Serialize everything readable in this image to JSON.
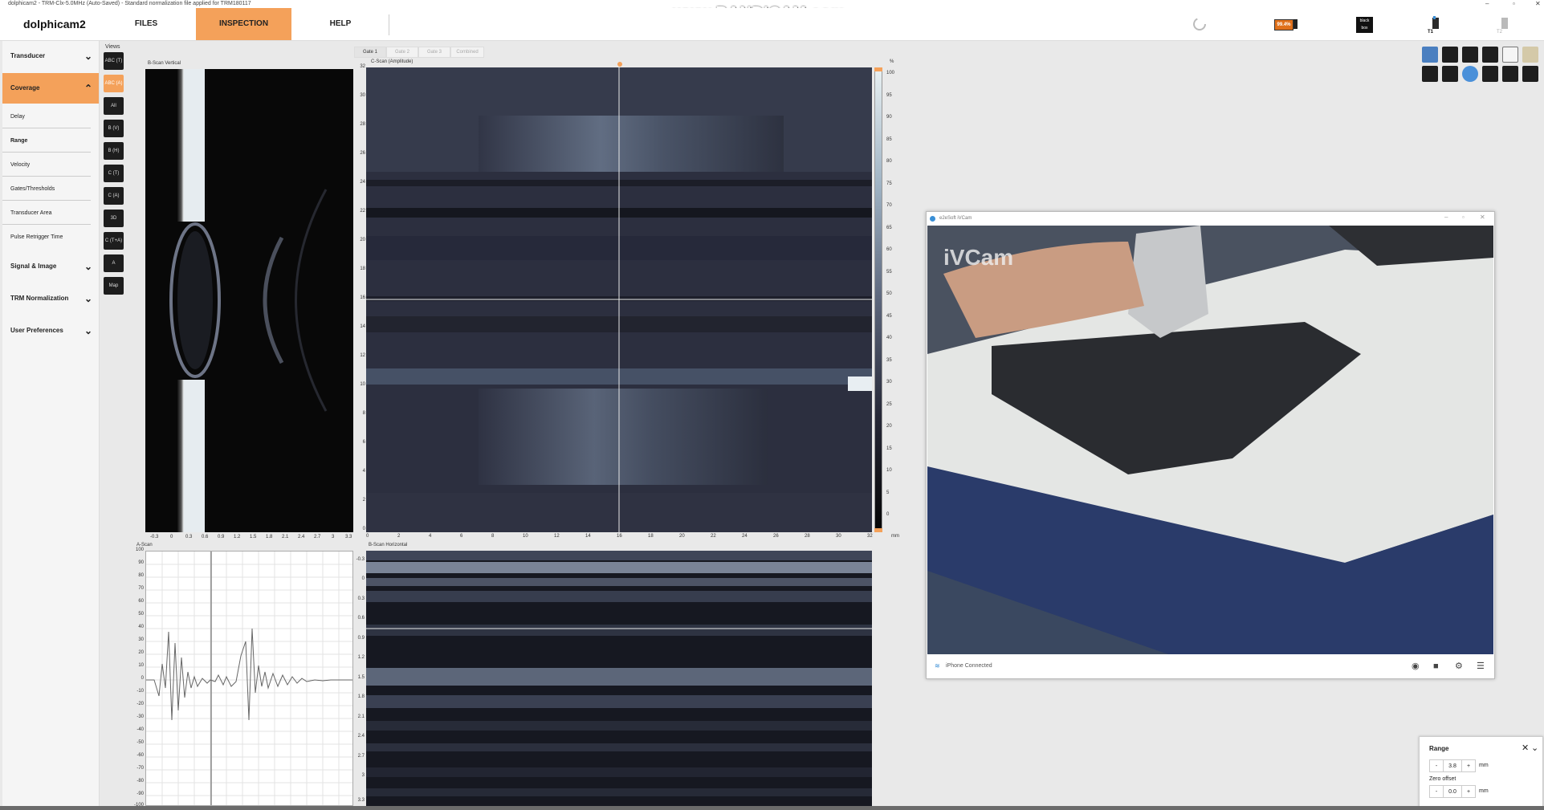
{
  "window": {
    "title": "dolphicam2 - TRM-Clx-5.0MHz (Auto-Saved) - Standard normalization file applied for TRM180117",
    "watermark": "www.BANDICAM.com"
  },
  "header": {
    "logo": "dolphicam2",
    "tabs": [
      {
        "label": "FILES"
      },
      {
        "label": "INSPECTION"
      },
      {
        "label": "HELP"
      }
    ],
    "battery_label": "99.4%",
    "blackbox_label": "black box",
    "t1_label": "T1",
    "t2_label": "T2"
  },
  "sidebar": {
    "sections": [
      {
        "label": "Transducer"
      },
      {
        "label": "Coverage"
      },
      {
        "label": "Signal & Image"
      },
      {
        "label": "TRM Normalization"
      },
      {
        "label": "User Preferences"
      }
    ],
    "coverage_items": [
      {
        "label": "Delay"
      },
      {
        "label": "Range"
      },
      {
        "label": "Velocity"
      },
      {
        "label": "Gates/Thresholds"
      },
      {
        "label": "Transducer Area"
      },
      {
        "label": "Pulse Retrigger Time"
      }
    ]
  },
  "views": {
    "label": "Views",
    "buttons": [
      {
        "label": "ABC (T)"
      },
      {
        "label": "ABC (A)"
      },
      {
        "label": "All"
      },
      {
        "label": "B (V)"
      },
      {
        "label": "B (H)"
      },
      {
        "label": "C (T)"
      },
      {
        "label": "C (A)"
      },
      {
        "label": "3D"
      },
      {
        "label": "C (T+A)"
      },
      {
        "label": "A"
      },
      {
        "label": "Map"
      }
    ]
  },
  "gates": {
    "tabs": [
      {
        "label": "Gate 1"
      },
      {
        "label": "Gate 2"
      },
      {
        "label": "Gate 3"
      },
      {
        "label": "Combined"
      }
    ]
  },
  "panels": {
    "bscan_vertical": {
      "title": "B-Scan Vertical",
      "x_ticks": [
        "-0.3",
        "0",
        "0.3",
        "0.6",
        "0.9",
        "1.2",
        "1.5",
        "1.8",
        "2.1",
        "2.4",
        "2.7",
        "3",
        "3.3"
      ]
    },
    "cscan": {
      "title": "C-Scan (Amplitude)",
      "y_ticks": [
        "32",
        "30",
        "28",
        "26",
        "24",
        "22",
        "20",
        "18",
        "16",
        "14",
        "12",
        "10",
        "8",
        "6",
        "4",
        "2",
        "0"
      ],
      "x_ticks": [
        "0",
        "2",
        "4",
        "6",
        "8",
        "10",
        "12",
        "14",
        "16",
        "18",
        "20",
        "22",
        "24",
        "26",
        "28",
        "30",
        "32"
      ],
      "x_unit": "mm",
      "colorbar_unit": "%",
      "colorbar_ticks": [
        "100",
        "95",
        "90",
        "85",
        "80",
        "75",
        "70",
        "65",
        "60",
        "55",
        "50",
        "45",
        "40",
        "35",
        "30",
        "25",
        "20",
        "15",
        "10",
        "5",
        "0"
      ]
    },
    "ascan": {
      "title": "A-Scan",
      "y_ticks": [
        "100",
        "90",
        "80",
        "70",
        "60",
        "50",
        "40",
        "30",
        "20",
        "10",
        "0",
        "-10",
        "-20",
        "-30",
        "-40",
        "-50",
        "-60",
        "-70",
        "-80",
        "-90",
        "-100"
      ]
    },
    "bscan_horizontal": {
      "title": "B-Scan Horizontal",
      "y_ticks": [
        "-0.3",
        "0",
        "0.3",
        "0.6",
        "0.9",
        "1.2",
        "1.5",
        "1.8",
        "2.1",
        "2.4",
        "2.7",
        "3",
        "3.3"
      ]
    }
  },
  "video_window": {
    "title": "e2eSoft iVCam",
    "overlay_label": "iVCam",
    "status": "iPhone Connected"
  },
  "range_popup": {
    "title": "Range",
    "range_value": "3.8",
    "range_unit": "mm",
    "zero_offset_label": "Zero offset",
    "zero_offset_value": "0.0",
    "zero_offset_unit": "mm",
    "minus_label": "-",
    "plus_label": "+"
  }
}
